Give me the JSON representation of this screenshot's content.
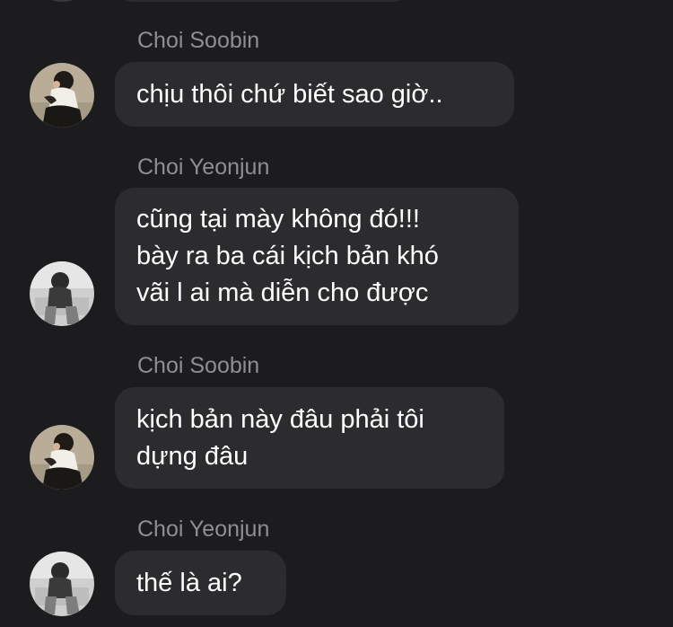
{
  "colors": {
    "background": "#1c1c1e",
    "bubble": "#2c2c2e",
    "sender_name": "#8e8e93",
    "message_text": "#ffffff"
  },
  "messages": [
    {
      "sender": "Choi Soobin",
      "avatar": "soobin-avatar",
      "lines": [
        "chịu thôi chứ biết sao giờ.."
      ]
    },
    {
      "sender": "Choi Yeonjun",
      "avatar": "yeonjun-avatar",
      "lines": [
        "cũng tại mày không đó!!!",
        "bày ra ba cái kịch bản khó",
        "vãi l ai mà diễn cho được"
      ]
    },
    {
      "sender": "Choi Soobin",
      "avatar": "soobin-avatar",
      "lines": [
        "kịch bản này đâu phải tôi",
        "dựng đâu"
      ]
    },
    {
      "sender": "Choi Yeonjun",
      "avatar": "yeonjun-avatar",
      "lines": [
        "thế là ai?"
      ]
    }
  ]
}
